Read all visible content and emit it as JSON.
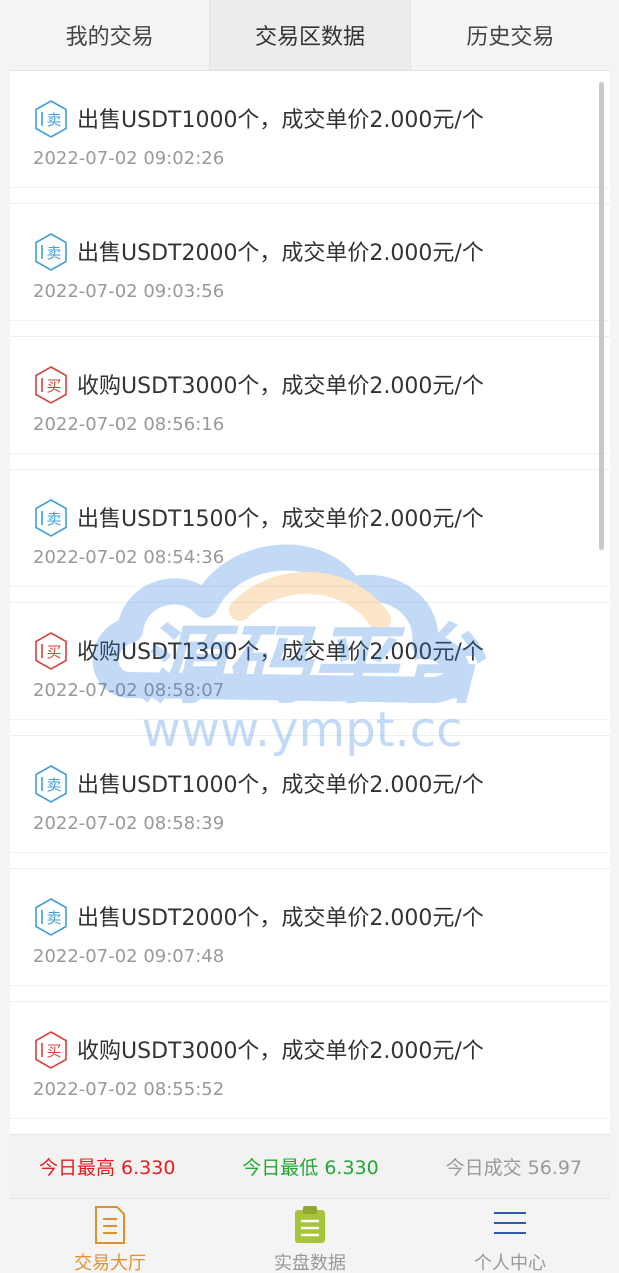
{
  "tabs": [
    {
      "label": "我的交易",
      "active": false
    },
    {
      "label": "交易区数据",
      "active": true
    },
    {
      "label": "历史交易",
      "active": false
    }
  ],
  "badges": {
    "sell": "卖",
    "buy": "买"
  },
  "colors": {
    "sell": "#3f9fd6",
    "buy": "#d9413a",
    "high": "#e02020",
    "low": "#22a733",
    "nav_active": "#e0912f"
  },
  "trades": [
    {
      "type": "sell",
      "text": "出售USDT1000个，成交单价2.000元/个",
      "time": "2022-07-02 09:02:26"
    },
    {
      "type": "sell",
      "text": "出售USDT2000个，成交单价2.000元/个",
      "time": "2022-07-02 09:03:56"
    },
    {
      "type": "buy",
      "text": "收购USDT3000个，成交单价2.000元/个",
      "time": "2022-07-02 08:56:16"
    },
    {
      "type": "sell",
      "text": "出售USDT1500个，成交单价2.000元/个",
      "time": "2022-07-02 08:54:36"
    },
    {
      "type": "buy",
      "text": "收购USDT1300个，成交单价2.000元/个",
      "time": "2022-07-02 08:58:07"
    },
    {
      "type": "sell",
      "text": "出售USDT1000个，成交单价2.000元/个",
      "time": "2022-07-02 08:58:39"
    },
    {
      "type": "sell",
      "text": "出售USDT2000个，成交单价2.000元/个",
      "time": "2022-07-02 09:07:48"
    },
    {
      "type": "buy",
      "text": "收购USDT3000个，成交单价2.000元/个",
      "time": "2022-07-02 08:55:52"
    }
  ],
  "watermark": {
    "logo_text": "源码平台",
    "url_text": "www.ympt.cc"
  },
  "stats": {
    "high": "今日最高 6.330",
    "low": "今日最低 6.330",
    "volume": "今日成交 56.97"
  },
  "nav": [
    {
      "label": "交易大厅",
      "icon": "document-icon",
      "active": true
    },
    {
      "label": "实盘数据",
      "icon": "clipboard-icon",
      "active": false
    },
    {
      "label": "个人中心",
      "icon": "menu-lines-icon",
      "active": false
    }
  ]
}
